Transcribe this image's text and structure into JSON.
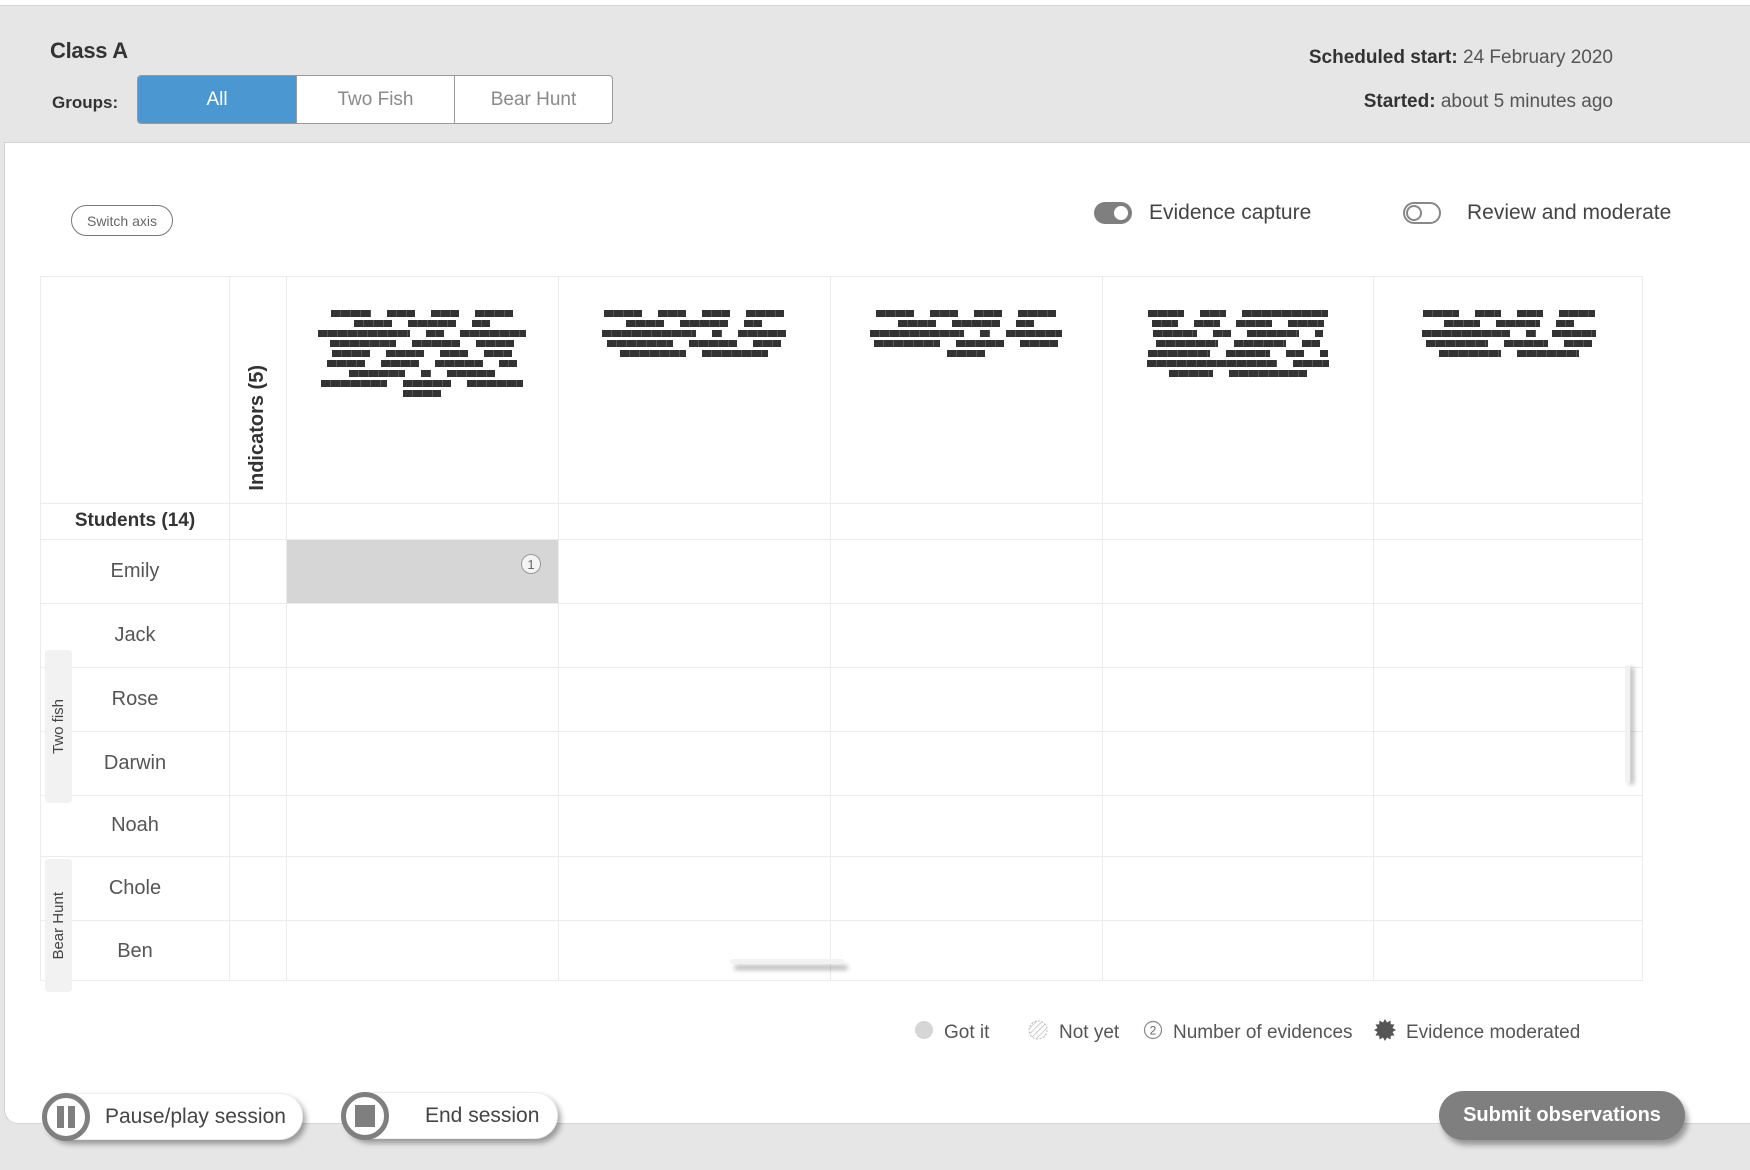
{
  "header": {
    "class_title": "Class A",
    "groups_label": "Groups:",
    "groups": [
      {
        "label": "All",
        "active": true
      },
      {
        "label": "Two Fish",
        "active": false
      },
      {
        "label": "Bear Hunt",
        "active": false
      }
    ],
    "scheduled_start_label": "Scheduled start:",
    "scheduled_start_value": "24 February 2020",
    "started_label": "Started:",
    "started_value": "about 5 minutes ago"
  },
  "controls": {
    "switch_axis_label": "Switch axis",
    "evidence_capture": {
      "label": "Evidence capture",
      "on": true
    },
    "review_moderate": {
      "label": "Review and moderate",
      "on": false
    }
  },
  "grid": {
    "indicators_label": "Indicators (5)",
    "students_label": "Students (14)",
    "indicators": [
      {
        "header": "[redacted]"
      },
      {
        "header": "[redacted]"
      },
      {
        "header": "[redacted]"
      },
      {
        "header": "[redacted]"
      },
      {
        "header": "[redacted]"
      }
    ],
    "groups": [
      {
        "label": "Two fish"
      },
      {
        "label": "Bear Hunt"
      }
    ],
    "students": [
      {
        "name": "Emily",
        "cells": [
          {
            "status": "got-it",
            "evidences": "1"
          },
          null,
          null,
          null,
          null
        ]
      },
      {
        "name": "Jack",
        "cells": [
          null,
          null,
          null,
          null,
          null
        ]
      },
      {
        "name": "Rose",
        "cells": [
          null,
          null,
          null,
          null,
          null
        ]
      },
      {
        "name": "Darwin",
        "cells": [
          null,
          null,
          null,
          null,
          null
        ]
      },
      {
        "name": "Noah",
        "cells": [
          null,
          null,
          null,
          null,
          null
        ]
      },
      {
        "name": "Chole",
        "cells": [
          null,
          null,
          null,
          null,
          null
        ]
      },
      {
        "name": "Ben",
        "cells": [
          null,
          null,
          null,
          null,
          null
        ]
      }
    ]
  },
  "legend": {
    "got_it": "Got it",
    "not_yet": "Not yet",
    "number_example": "2",
    "number_of_evidences": "Number of evidences",
    "evidence_moderated": "Evidence moderated"
  },
  "footer": {
    "pause_label": "Pause/play session",
    "end_label": "End session",
    "submit_label": "Submit observations"
  },
  "colors": {
    "accent": "#4a97d1",
    "header_bg": "#e6e6e6",
    "got_it_fill": "#d6d6d6",
    "button_gray": "#7f7f7f"
  }
}
